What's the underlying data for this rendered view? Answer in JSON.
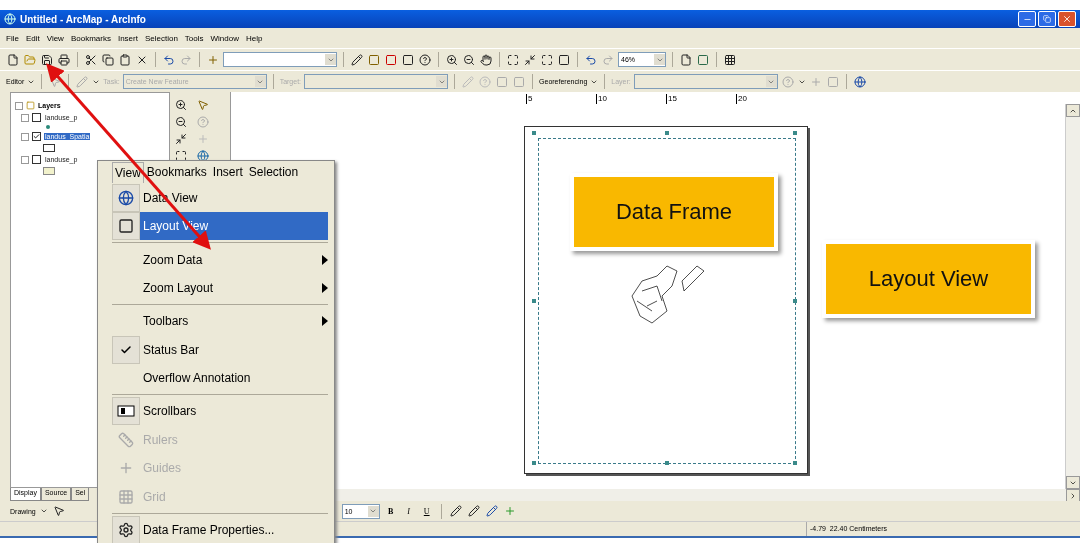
{
  "window": {
    "title": "Untitled - ArcMap - ArcInfo"
  },
  "menu_bar": [
    "File",
    "Edit",
    "View",
    "Bookmarks",
    "Insert",
    "Selection",
    "Tools",
    "Window",
    "Help"
  ],
  "standard_toolbar": {
    "zoom_value": "46%"
  },
  "editor_toolbar": {
    "editor": "Editor",
    "task_label": "Task:",
    "task_value": "Create New Feature",
    "target_label": "Target:",
    "georeferencing": "Georeferencing",
    "layer_label": "Layer:"
  },
  "toc": {
    "root": "Layers",
    "layers": [
      {
        "name": "landuse_p",
        "checked": false,
        "selected": false
      },
      {
        "name": "landus_Spatia",
        "checked": true,
        "selected": true
      },
      {
        "name": "landuse_p",
        "checked": false,
        "selected": false
      }
    ],
    "tabs": [
      {
        "label": "Display",
        "selected": true
      },
      {
        "label": "Source",
        "selected": false
      },
      {
        "label": "Sel",
        "selected": false
      }
    ]
  },
  "ruler": [
    "5",
    "10",
    "15",
    "20"
  ],
  "context_menu": {
    "header": [
      {
        "label": "View",
        "selected": true
      },
      {
        "label": "Bookmarks",
        "selected": false
      },
      {
        "label": "Insert",
        "selected": false
      },
      {
        "label": "Selection",
        "selected": false
      }
    ],
    "items": [
      {
        "kind": "item",
        "label": "Data View",
        "selected": false,
        "disabled": false
      },
      {
        "kind": "item",
        "label": "Layout View",
        "selected": true,
        "disabled": false
      },
      {
        "kind": "separator"
      },
      {
        "kind": "submenu",
        "label": "Zoom Data",
        "selected": false,
        "disabled": false
      },
      {
        "kind": "submenu",
        "label": "Zoom Layout",
        "selected": false,
        "disabled": false
      },
      {
        "kind": "separator"
      },
      {
        "kind": "submenu",
        "label": "Toolbars",
        "selected": false,
        "disabled": false
      },
      {
        "kind": "check",
        "label": "Status Bar",
        "checked": true,
        "disabled": false
      },
      {
        "kind": "check",
        "label": "Overflow Annotation",
        "checked": false,
        "disabled": false
      },
      {
        "kind": "separator"
      },
      {
        "kind": "item",
        "label": "Scrollbars",
        "selected": false,
        "disabled": false
      },
      {
        "kind": "item",
        "label": "Rulers",
        "selected": false,
        "disabled": true
      },
      {
        "kind": "item",
        "label": "Guides",
        "selected": false,
        "disabled": true
      },
      {
        "kind": "item",
        "label": "Grid",
        "selected": false,
        "disabled": true
      },
      {
        "kind": "separator"
      },
      {
        "kind": "item",
        "label": "Data Frame Properties...",
        "selected": false,
        "disabled": false
      }
    ]
  },
  "callouts": [
    "Data Frame",
    "Layout View"
  ],
  "drawing_toolbar": {
    "label": "Drawing",
    "font_size": "10",
    "bold": "B",
    "italic": "I",
    "underline": "U"
  },
  "status_bar": {
    "coordinates": "-4.79  22.40 Centimeters"
  }
}
